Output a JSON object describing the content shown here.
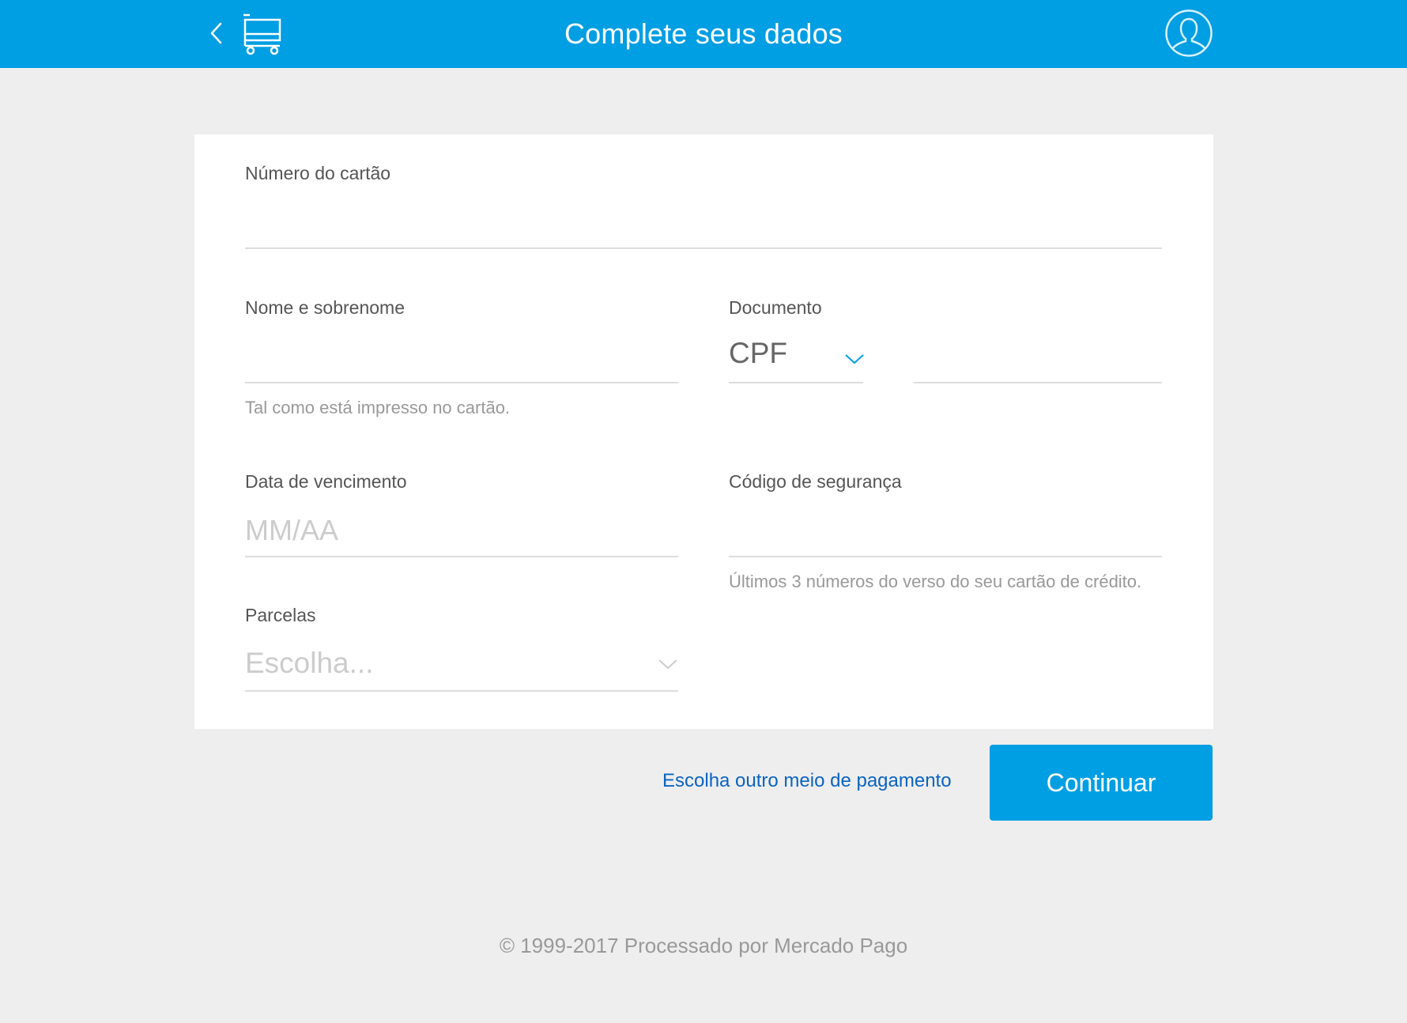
{
  "header": {
    "title": "Complete seus dados",
    "back_icon": "chevron-left-icon",
    "cart_icon": "shopping-cart-icon",
    "avatar_icon": "user-icon",
    "background_color": "#009ee3"
  },
  "form": {
    "card_number": {
      "label": "Número do cartão",
      "value": "",
      "placeholder": ""
    },
    "full_name": {
      "label": "Nome e sobrenome",
      "value": "",
      "placeholder": "",
      "hint": "Tal como está impresso no cartão."
    },
    "document": {
      "label": "Documento",
      "type_selected": "CPF",
      "number_value": ""
    },
    "expiration": {
      "label": "Data de vencimento",
      "value": "",
      "placeholder": "MM/AA"
    },
    "security_code": {
      "label": "Código de segurança",
      "value": "",
      "placeholder": "",
      "hint": "Últimos 3 números do verso do seu cartão de crédito."
    },
    "installments": {
      "label": "Parcelas",
      "placeholder": "Escolha..."
    }
  },
  "actions": {
    "alt_payment_link": "Escolha outro meio de pagamento",
    "continue_label": "Continuar",
    "accent_color": "#009ee3",
    "link_color": "#0a63c2"
  },
  "footer": {
    "text": "© 1999-2017 Processado por Mercado Pago"
  }
}
